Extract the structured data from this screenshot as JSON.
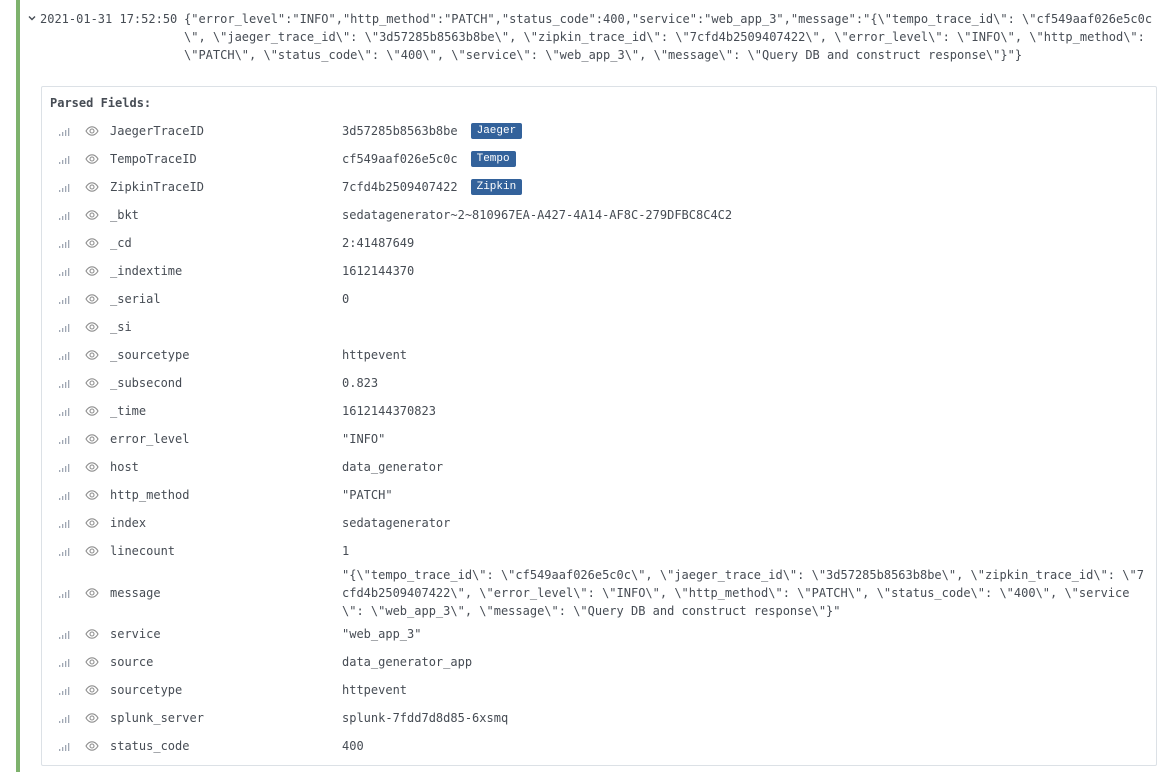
{
  "log_entry": {
    "timestamp": "2021-01-31 17:52:50",
    "message": "{\"error_level\":\"INFO\",\"http_method\":\"PATCH\",\"status_code\":400,\"service\":\"web_app_3\",\"message\":\"{\\\"tempo_trace_id\\\": \\\"cf549aaf026e5c0c\\\", \\\"jaeger_trace_id\\\": \\\"3d57285b8563b8be\\\", \\\"zipkin_trace_id\\\": \\\"7cfd4b2509407422\\\", \\\"error_level\\\": \\\"INFO\\\", \\\"http_method\\\": \\\"PATCH\\\", \\\"status_code\\\": \\\"400\\\", \\\"service\\\": \\\"web_app_3\\\", \\\"message\\\": \\\"Query DB and construct response\\\"}\"}"
  },
  "details": {
    "title": "Parsed Fields:",
    "fields": [
      {
        "name": "JaegerTraceID",
        "value": "3d57285b8563b8be",
        "link": "Jaeger"
      },
      {
        "name": "TempoTraceID",
        "value": "cf549aaf026e5c0c",
        "link": "Tempo"
      },
      {
        "name": "ZipkinTraceID",
        "value": "7cfd4b2509407422",
        "link": "Zipkin"
      },
      {
        "name": "_bkt",
        "value": "sedatagenerator~2~810967EA-A427-4A14-AF8C-279DFBC8C4C2"
      },
      {
        "name": "_cd",
        "value": "2:41487649"
      },
      {
        "name": "_indextime",
        "value": "1612144370"
      },
      {
        "name": "_serial",
        "value": "0"
      },
      {
        "name": "_si",
        "value": ""
      },
      {
        "name": "_sourcetype",
        "value": "httpevent"
      },
      {
        "name": "_subsecond",
        "value": "0.823"
      },
      {
        "name": "_time",
        "value": "1612144370823"
      },
      {
        "name": "error_level",
        "value": "\"INFO\""
      },
      {
        "name": "host",
        "value": "data_generator"
      },
      {
        "name": "http_method",
        "value": "\"PATCH\""
      },
      {
        "name": "index",
        "value": "sedatagenerator"
      },
      {
        "name": "linecount",
        "value": "1"
      },
      {
        "name": "message",
        "value": "\"{\\\"tempo_trace_id\\\": \\\"cf549aaf026e5c0c\\\", \\\"jaeger_trace_id\\\": \\\"3d57285b8563b8be\\\", \\\"zipkin_trace_id\\\": \\\"7cfd4b2509407422\\\", \\\"error_level\\\": \\\"INFO\\\", \\\"http_method\\\": \\\"PATCH\\\", \\\"status_code\\\": \\\"400\\\", \\\"service\\\": \\\"web_app_3\\\", \\\"message\\\": \\\"Query DB and construct response\\\"}\"",
        "tall": true
      },
      {
        "name": "service",
        "value": "\"web_app_3\""
      },
      {
        "name": "source",
        "value": "data_generator_app"
      },
      {
        "name": "sourcetype",
        "value": "httpevent"
      },
      {
        "name": "splunk_server",
        "value": "splunk-7fdd7d8d85-6xsmq"
      },
      {
        "name": "status_code",
        "value": "400"
      }
    ]
  },
  "icons": {
    "expand": "chevron-down-icon",
    "stats": "signal-bars-icon",
    "visibility": "eye-icon"
  },
  "colors": {
    "level_bar": "#7eb26d",
    "link_badge": "#33629b",
    "text": "#464c54",
    "icon": "#8e8e8e"
  }
}
